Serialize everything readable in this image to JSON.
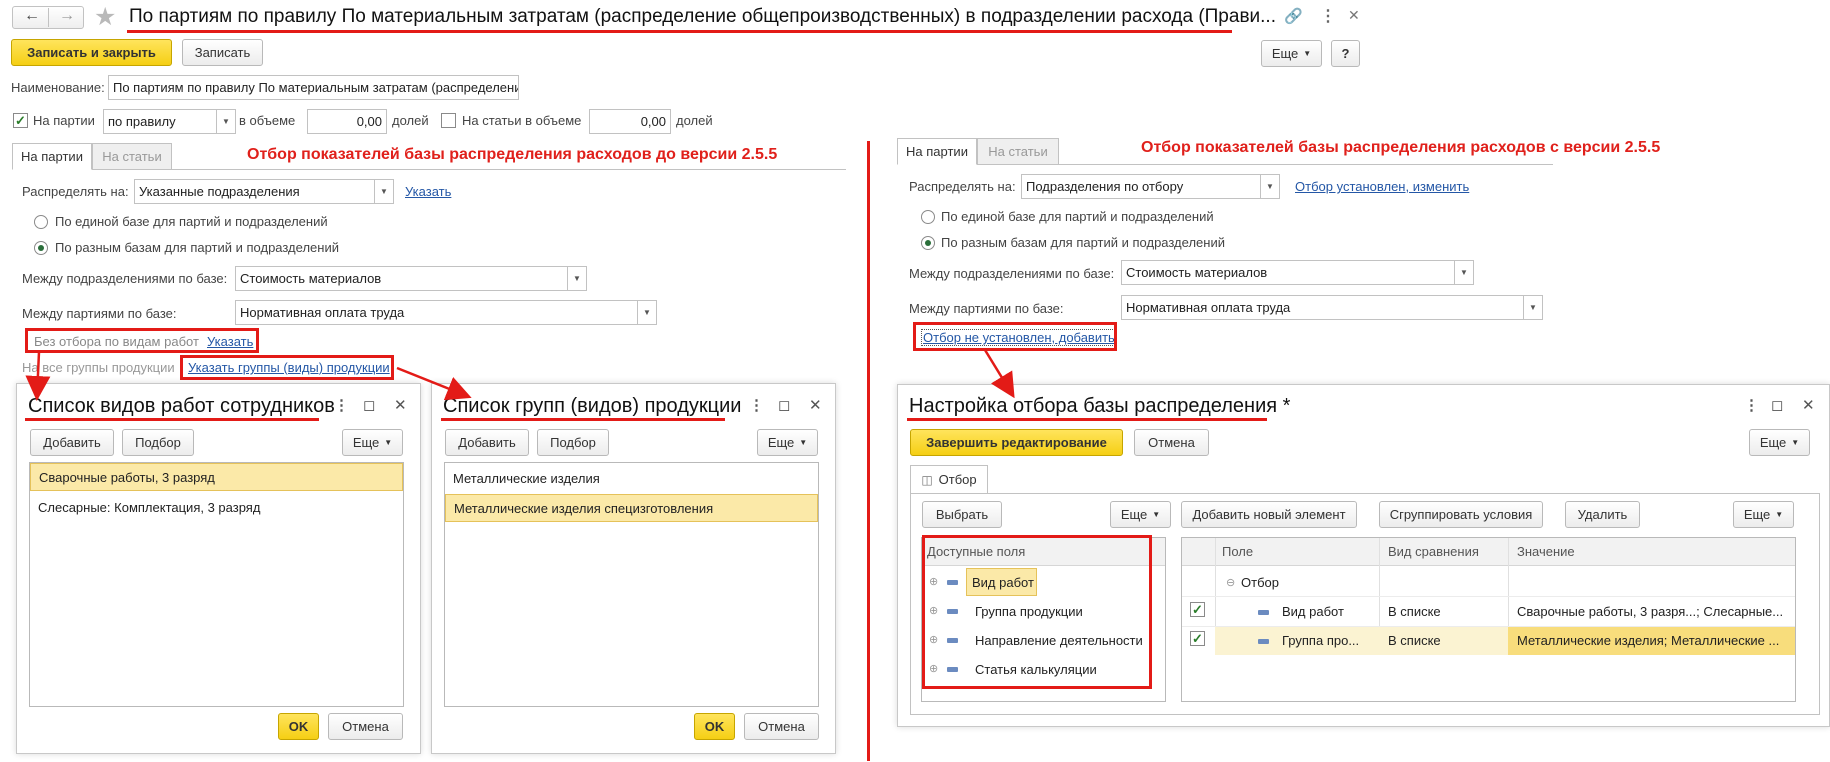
{
  "window": {
    "title": "По партиям по правилу По материальным затратам (распределение общепроизводственных) в подразделении расхода (Прави...",
    "back_icon": "arrow-left-icon",
    "forward_icon": "arrow-right-icon",
    "star_icon": "star-icon"
  },
  "toolbar": {
    "save_close": "Записать и закрыть",
    "save": "Записать",
    "more": "Еще",
    "help": "?"
  },
  "form": {
    "name_label": "Наименование:",
    "name_value": "По партиям по правилу По материальным затратам (распределени",
    "on_batches_label": "На партии",
    "rule_value": "по правилу",
    "volume_label": "в объеме",
    "volume_value": "0,00",
    "shares_label": "долей",
    "on_items_label": "На статьи в объеме",
    "items_volume_value": "0,00",
    "items_shares_label": "долей"
  },
  "annotations": {
    "before": "Отбор показателей базы распределения расходов до версии 2.5.5",
    "after": "Отбор показателей базы распределения расходов с версии 2.5.5"
  },
  "left_form": {
    "tab_batches": "На партии",
    "tab_items": "На статьи",
    "distribute_label": "Распределять на:",
    "distribute_value": "Указанные подразделения",
    "specify_link": "Указать",
    "radio1": "По единой базе для партий и подразделений",
    "radio2": "По разным базам для партий и подразделений",
    "between_depts_label": "Между подразделениями по базе:",
    "between_depts_value": "Стоимость материалов",
    "between_batches_label": "Между партиями по базе:",
    "between_batches_value": "Нормативная оплата труда",
    "no_filter_label": "Без отбора по видам работ",
    "no_filter_link": "Указать",
    "all_groups_label": "На все группы продукции",
    "groups_link": "Указать группы (виды) продукции"
  },
  "right_form": {
    "tab_batches": "На партии",
    "tab_items": "На статьи",
    "distribute_label": "Распределять на:",
    "distribute_value": "Подразделения по отбору",
    "filter_link": "Отбор установлен, изменить",
    "radio1": "По единой базе для партий и подразделений",
    "radio2": "По разным базам для партий и подразделений",
    "between_depts_label": "Между подразделениями по базе:",
    "between_depts_value": "Стоимость материалов",
    "between_batches_label": "Между партиями по базе:",
    "between_batches_value": "Нормативная оплата труда",
    "filter_not_set_link": "Отбор не установлен, добавить"
  },
  "work_types_window": {
    "title": "Список видов работ сотрудников",
    "add": "Добавить",
    "pick": "Подбор",
    "more": "Еще",
    "items": [
      "Сварочные работы, 3 разряд",
      "Слесарные: Комплектация, 3 разряд"
    ],
    "ok": "OK",
    "cancel": "Отмена"
  },
  "groups_window": {
    "title": "Список групп (видов) продукции",
    "add": "Добавить",
    "pick": "Подбор",
    "more": "Еще",
    "items": [
      "Металлические изделия",
      "Металлические изделия специзготовления"
    ],
    "ok": "OK",
    "cancel": "Отмена"
  },
  "filter_window": {
    "title": "Настройка отбора базы распределения *",
    "finish": "Завершить редактирование",
    "cancel": "Отмена",
    "more": "Еще",
    "tab": "Отбор",
    "select": "Выбрать",
    "more_left": "Еще",
    "add_new": "Добавить новый элемент",
    "group_conditions": "Сгруппировать условия",
    "delete": "Удалить",
    "more_right": "Еще",
    "fields_header": "Доступные поля",
    "fields": [
      "Вид работ",
      "Группа продукции",
      "Направление деятельности",
      "Статья калькуляции"
    ],
    "col_field": "Поле",
    "col_comparison": "Вид сравнения",
    "col_value": "Значение",
    "root": "Отбор",
    "rows": [
      {
        "field": "Вид работ",
        "comparison": "В списке",
        "value": "Сварочные работы, 3 разря...; Слесарные..."
      },
      {
        "field": "Группа про...",
        "comparison": "В списке",
        "value": "Металлические изделия; Металлические ..."
      }
    ]
  }
}
